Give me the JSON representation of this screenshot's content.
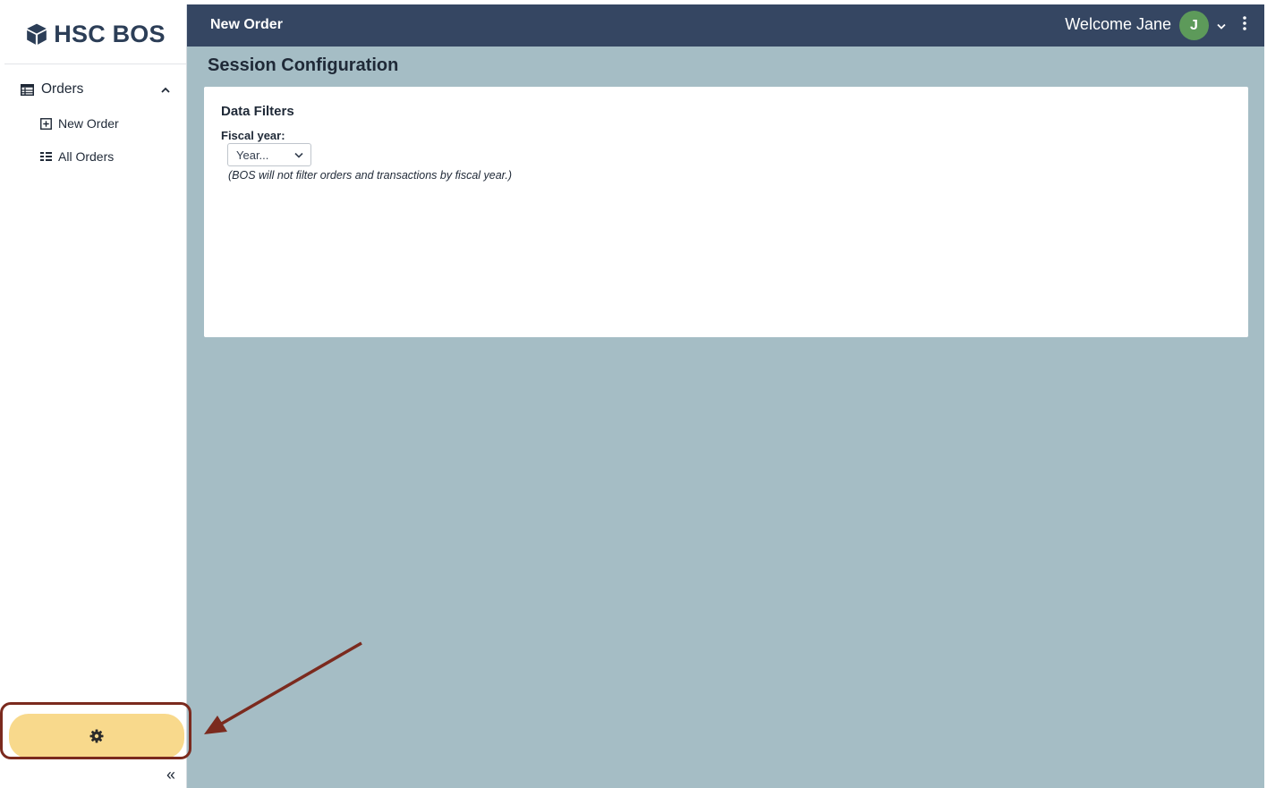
{
  "app": {
    "brand": "HSC BOS"
  },
  "sidebar": {
    "group": {
      "label": "Orders",
      "icon": "table-icon",
      "expanded": true
    },
    "items": [
      {
        "label": "New Order",
        "icon": "plus-square-icon"
      },
      {
        "label": "All Orders",
        "icon": "list-icon"
      }
    ],
    "settings_icon": "gear-icon",
    "collapse_glyph": "«"
  },
  "topbar": {
    "title": "New Order",
    "welcome": "Welcome Jane",
    "avatar_initial": "J"
  },
  "main": {
    "page_title": "Session Configuration",
    "card": {
      "title": "Data Filters",
      "field_label": "Fiscal year:",
      "select_value": "Year...",
      "hint": "(BOS will not filter orders and transactions by fiscal year.)"
    }
  },
  "colors": {
    "topbar_bg": "#354662",
    "content_bg": "#a5bdc5",
    "settings_bg": "#f8d98c",
    "annotation": "#7b2a1e",
    "avatar_bg": "#5d9a5a"
  }
}
